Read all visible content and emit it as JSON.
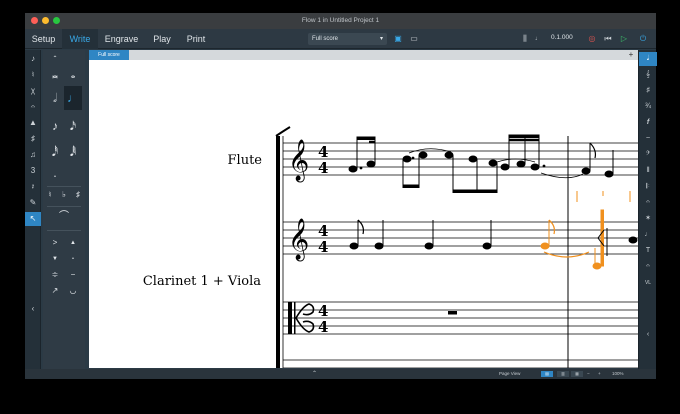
{
  "window": {
    "title": "Flow 1 in Untitled Project 1"
  },
  "modes": [
    "Setup",
    "Write",
    "Engrave",
    "Play",
    "Print"
  ],
  "active_mode": "Write",
  "layout_select": {
    "value": "Full score"
  },
  "transport": {
    "position": "0.1.000"
  },
  "score_tab": {
    "label": "Full score",
    "add": "+"
  },
  "score": {
    "instruments": [
      "Flute",
      "Clarinet 1 + Viola"
    ],
    "time_signature": {
      "upper": "4",
      "lower": "4"
    }
  },
  "status": {
    "view": "Page View",
    "zoom": "100%"
  },
  "colors": {
    "accent": "#39a9e8",
    "selection": "#f0901e",
    "chrome": "#2b3a45",
    "tab_blue": "#2f86c4"
  }
}
